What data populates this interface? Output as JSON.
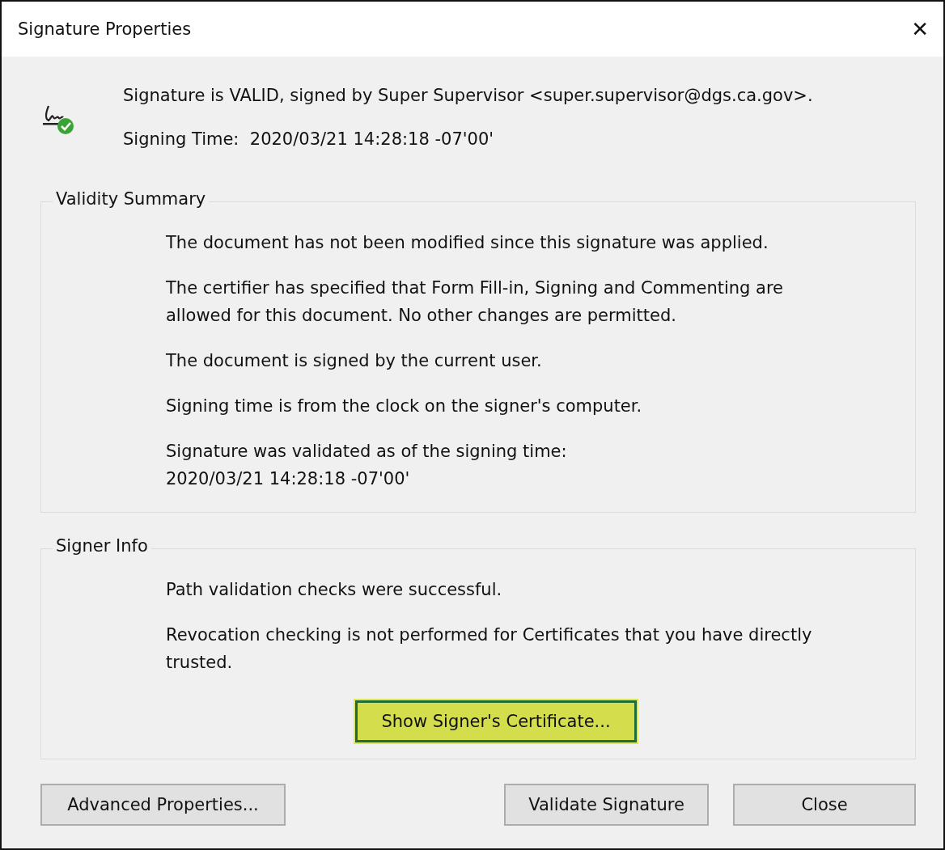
{
  "window": {
    "title": "Signature Properties",
    "close_glyph": "✕"
  },
  "header": {
    "status_line": "Signature is VALID, signed by Super Supervisor <super.supervisor@dgs.ca.gov>.",
    "signing_time": "Signing Time:  2020/03/21 14:28:18 -07'00'"
  },
  "groups": [
    {
      "title": "Validity Summary",
      "paragraphs": [
        "The document has not been modified since this signature was applied.",
        "The certifier has specified that Form Fill-in, Signing and Commenting are allowed for this document. No other changes are permitted.",
        "The document is signed by the current user.",
        "Signing time is from the clock on the signer's computer.",
        "Signature was validated as of the signing time:\n2020/03/21 14:28:18 -07'00'"
      ]
    },
    {
      "title": "Signer Info",
      "paragraphs": [
        "Path validation checks were successful.",
        "Revocation checking is not performed for Certificates that you have directly trusted."
      ],
      "button": {
        "label": "Show Signer's Certificate...",
        "highlighted": true
      }
    }
  ],
  "left_buttons": [
    "Advanced Properties..."
  ],
  "right_buttons": [
    "Validate Signature",
    "Close"
  ]
}
